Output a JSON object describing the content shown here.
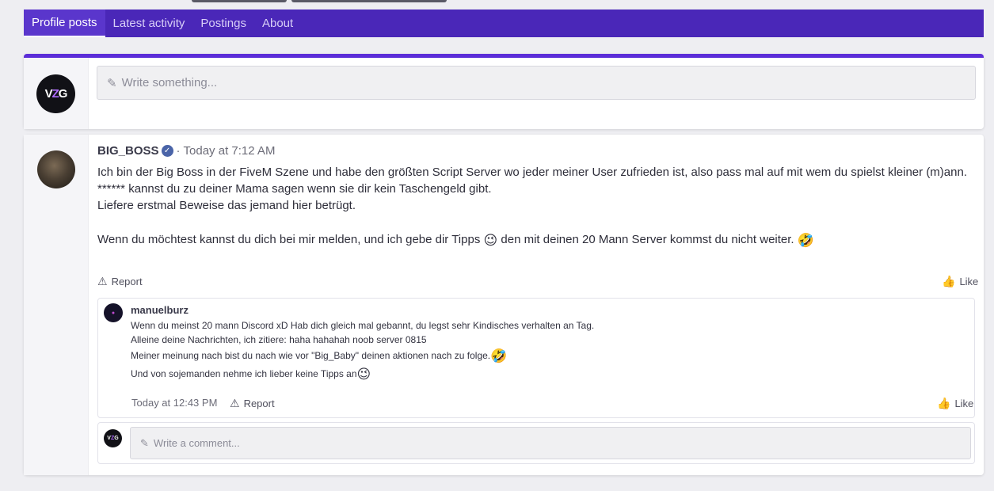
{
  "tabs": [
    {
      "label": "Profile posts",
      "active": true
    },
    {
      "label": "Latest activity",
      "active": false
    },
    {
      "label": "Postings",
      "active": false
    },
    {
      "label": "About",
      "active": false
    }
  ],
  "composer": {
    "avatar_text_left": "V",
    "avatar_text_mid": "Z",
    "avatar_text_right": "G",
    "placeholder": "Write something..."
  },
  "post": {
    "author": "BIG_BOSS",
    "separator": "·",
    "time": "Today at 7:12 AM",
    "body": {
      "line1": "Ich bin der Big Boss in der FiveM Szene und habe den größten Script Server wo jeder meiner User zufrieden ist, also pass mal auf mit wem du spielst kleiner (m)ann.",
      "line2": "****** kannst du zu deiner Mama sagen wenn sie dir kein Taschengeld gibt.",
      "line3": "Liefere erstmal Beweise das jemand hier betrügt.",
      "line4a": "Wenn du möchtest kannst du dich bei mir melden, und ich gebe dir Tipps ",
      "emoji_wink": "😉",
      "line4b": " den mit deinen 20 Mann Server kommst du nicht weiter. ",
      "emoji_rofl": "🤣"
    },
    "report_label": "Report",
    "like_label": "Like"
  },
  "reply": {
    "author": "manuelburz",
    "lines": [
      "Wenn du meinst 20 mann Discord xD Hab dich gleich mal gebannt, du legst sehr Kindisches verhalten an Tag.",
      "Alleine deine Nachrichten, ich zitiere: haha hahahah noob server 0815",
      "Meiner meinung nach bist du nach wie vor \"Big_Baby\" deinen aktionen nach zu folge.",
      "Und von sojemanden nehme ich lieber keine Tipps an"
    ],
    "emoji_rofl": "🤣",
    "emoji_wink": "😉",
    "time": "Today at 12:43 PM",
    "report_label": "Report",
    "like_label": "Like"
  },
  "comment": {
    "placeholder": "Write a comment..."
  },
  "colors": {
    "nav_bg": "#4a27b8",
    "accent": "#5b2dd8"
  }
}
